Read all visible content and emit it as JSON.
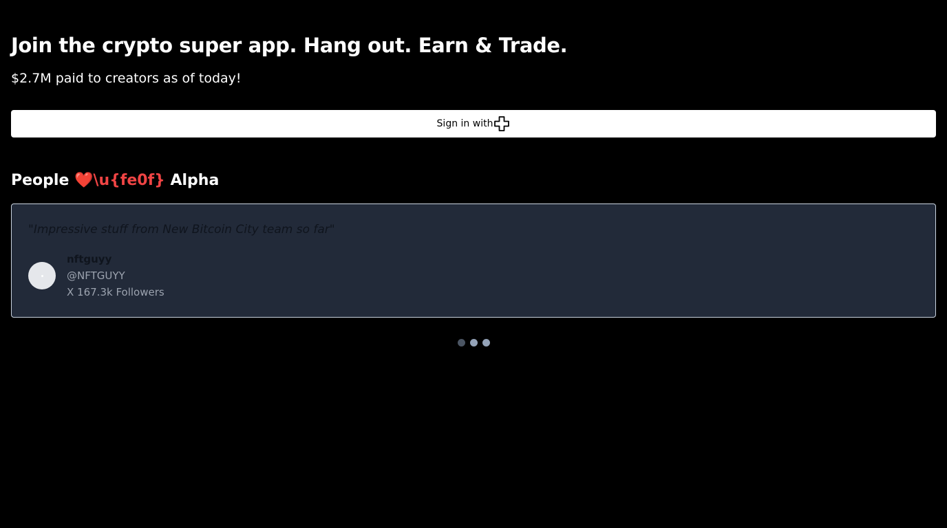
{
  "hero": {
    "title": "Join the crypto super app. Hang out. Earn & Trade.",
    "subtitle": "$2.7M paid to creators as of today!"
  },
  "signin": {
    "label": "Sign in with",
    "icon": "cross-icon"
  },
  "section": {
    "title_prefix": "People ",
    "heart": "❤️\\u{fe0f}",
    "title_suffix": " Alpha"
  },
  "testimonial": {
    "quote": "\"Impressive stuff from New Bitcoin City team so far\"",
    "name": "nftguyy",
    "handle": "@NFTGUYY",
    "followers": "X 167.3k Followers"
  },
  "carousel": {
    "count": 3,
    "active_index": 0
  },
  "colors": {
    "background": "#000000",
    "card": "#222a39",
    "accent_heart": "#ef4444",
    "button": "#ffffff"
  }
}
